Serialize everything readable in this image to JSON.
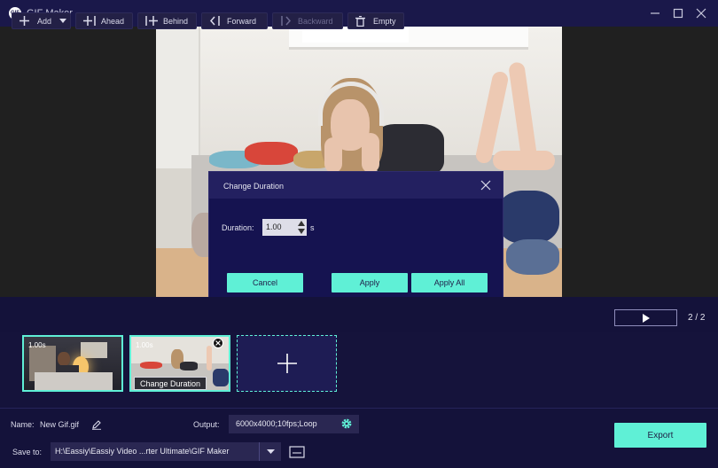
{
  "window": {
    "title": "GIF Maker",
    "logo_text": "GIF"
  },
  "dialog": {
    "title": "Change Duration",
    "duration_label": "Duration:",
    "duration_value": "1.00",
    "unit": "s",
    "cancel": "Cancel",
    "apply": "Apply",
    "apply_all": "Apply All"
  },
  "toolbar": {
    "add": "Add",
    "ahead": "Ahead",
    "behind": "Behind",
    "forward": "Forward",
    "backward": "Backward",
    "empty": "Empty",
    "page_count": "2 / 2"
  },
  "frames": [
    {
      "duration": "1.00s"
    },
    {
      "duration": "1.00s",
      "tooltip": "Change Duration"
    }
  ],
  "bottom": {
    "name_label": "Name:",
    "name_value": "New Gif.gif",
    "output_label": "Output:",
    "output_value": "6000x4000;10fps;Loop",
    "save_label": "Save to:",
    "save_path": "H:\\Eassiy\\Eassiy Video ...rter Ultimate\\GIF Maker",
    "export": "Export"
  },
  "colors": {
    "accent": "#5ff0d6",
    "background": "#15133b",
    "dialog": "#151350"
  },
  "icons": [
    "app-logo-icon",
    "minimize-icon",
    "maximize-icon",
    "close-icon",
    "plus-icon",
    "chevron-down-icon",
    "play-icon",
    "trash-icon",
    "edit-icon",
    "gear-icon",
    "folder-icon"
  ]
}
